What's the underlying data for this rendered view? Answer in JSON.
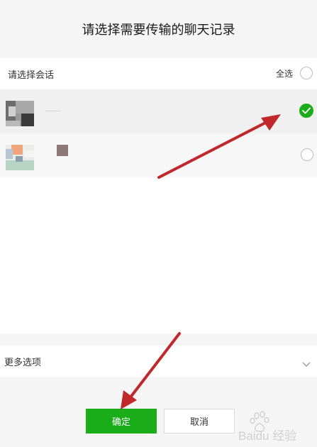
{
  "dialog": {
    "title": "请选择需要传输的聊天记录"
  },
  "list": {
    "header_label": "请选择会话",
    "select_all_label": "全选",
    "conversations": [
      {
        "selected": true
      },
      {
        "selected": false
      }
    ]
  },
  "more_options": {
    "label": "更多选项"
  },
  "buttons": {
    "confirm_label": "确定",
    "cancel_label": "取消"
  },
  "colors": {
    "accent_green": "#1aad19",
    "annotation_arrow": "#c0282b"
  },
  "icons": {
    "checkbox": "circle-checkbox-icon",
    "check": "check-icon",
    "more_toggle": "chevron-down-icon",
    "watermark": "baidu-jingyan-logo-icon"
  },
  "watermark": {
    "text": "Baidu 经验"
  }
}
